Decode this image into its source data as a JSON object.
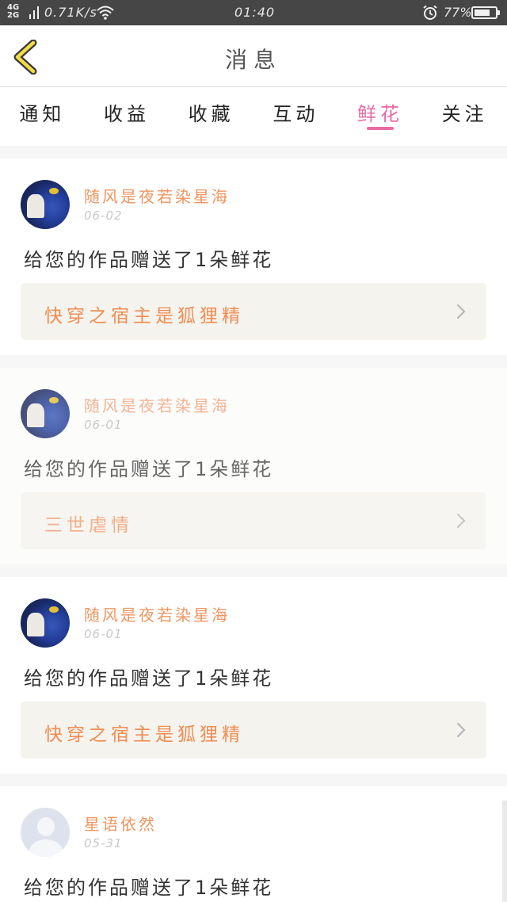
{
  "status_bar": {
    "network_top": "4G",
    "network_bottom": "2G",
    "speed": "0.71K/s",
    "time": "01:40",
    "battery_percent": "77%",
    "battery_level": 0.77
  },
  "header": {
    "title": "消息"
  },
  "tabs": [
    {
      "label": "通知"
    },
    {
      "label": "收益"
    },
    {
      "label": "收藏"
    },
    {
      "label": "互动"
    },
    {
      "label": "鲜花"
    },
    {
      "label": "关注"
    }
  ],
  "active_tab": "鲜花",
  "colors": {
    "accent": "#e86aa3",
    "username": "#ef9560",
    "work_title": "#ef8d52"
  },
  "messages": [
    {
      "username": "随风是夜若染星海",
      "date": "06-02",
      "text": "给您的作品赠送了1朵鲜花",
      "work": "快穿之宿主是狐狸精"
    },
    {
      "username": "随风是夜若染星海",
      "date": "06-01",
      "text": "给您的作品赠送了1朵鲜花",
      "work": "三世虐情"
    },
    {
      "username": "随风是夜若染星海",
      "date": "06-01",
      "text": "给您的作品赠送了1朵鲜花",
      "work": "快穿之宿主是狐狸精"
    },
    {
      "username": "星语依然",
      "date": "05-31",
      "text": "给您的作品赠送了1朵鲜花"
    }
  ]
}
